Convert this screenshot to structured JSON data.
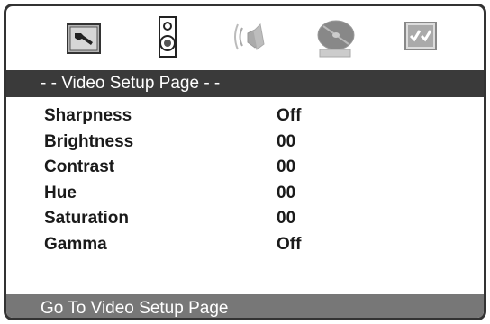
{
  "icons": [
    {
      "name": "general-setup-icon"
    },
    {
      "name": "speaker-setup-icon"
    },
    {
      "name": "audio-setup-icon"
    },
    {
      "name": "video-setup-icon"
    },
    {
      "name": "preference-setup-icon"
    }
  ],
  "title": "- - Video Setup Page - -",
  "settings": [
    {
      "label": "Sharpness",
      "value": "Off"
    },
    {
      "label": "Brightness",
      "value": "00"
    },
    {
      "label": "Contrast",
      "value": "00"
    },
    {
      "label": "Hue",
      "value": "00"
    },
    {
      "label": "Saturation",
      "value": "00"
    },
    {
      "label": "Gamma",
      "value": "Off"
    }
  ],
  "status": "Go To Video Setup Page"
}
